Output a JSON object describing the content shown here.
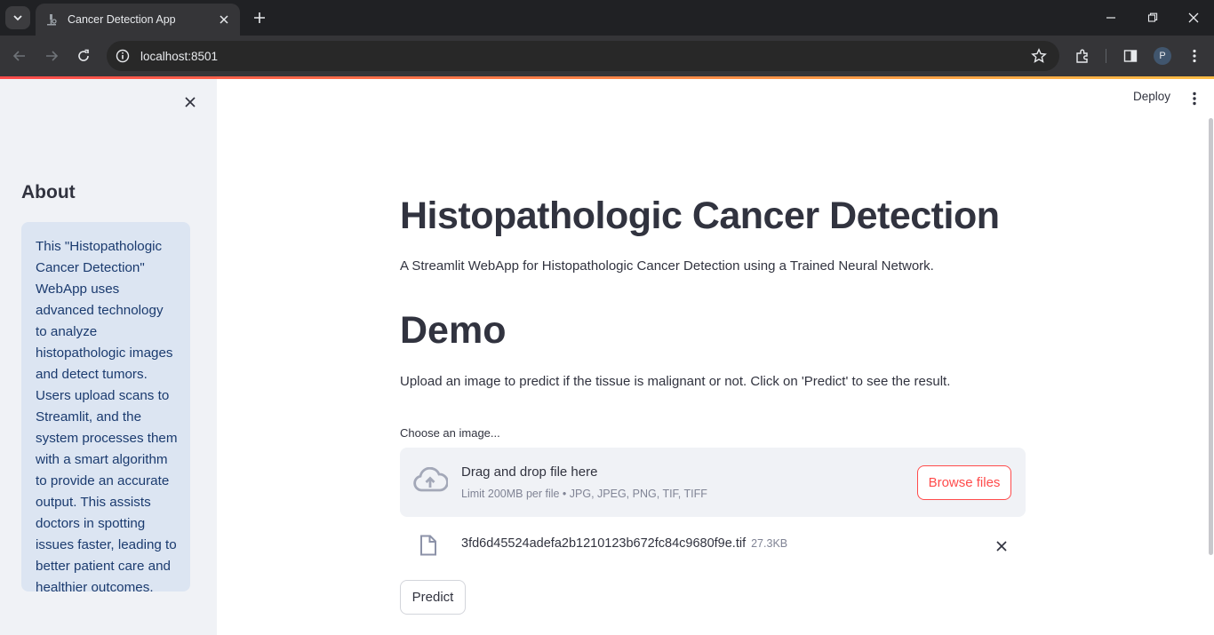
{
  "browser": {
    "tab_title": "Cancer Detection App",
    "url": "localhost:8501",
    "profile_initial": "P"
  },
  "header": {
    "deploy_label": "Deploy"
  },
  "sidebar": {
    "title": "About",
    "info_text": "This \"Histopathologic Cancer Detection\" WebApp uses advanced technology to analyze histopathologic images and detect tumors. Users upload scans to Streamlit, and the system processes them with a smart algorithm to provide an accurate output. This assists doctors in spotting issues faster, leading to better patient care and healthier outcomes."
  },
  "main": {
    "title": "Histopathologic Cancer Detection",
    "subtitle": "A Streamlit WebApp for Histopathologic Cancer Detection using a Trained Neural Network.",
    "section_title": "Demo",
    "instructions": "Upload an image to predict if the tissue is malignant or not. Click on 'Predict' to see the result.",
    "uploader": {
      "label": "Choose an image...",
      "drop_text": "Drag and drop file here",
      "limit_text": "Limit 200MB per file • JPG, JPEG, PNG, TIF, TIFF",
      "browse_label": "Browse files",
      "file_name": "3fd6d45524adefa2b1210123b672fc84c9680f9e.tif",
      "file_size": "27.3KB"
    },
    "predict_label": "Predict"
  },
  "colors": {
    "accent": "#ff4b4b",
    "sidebar_bg": "#f0f2f6",
    "info_bg": "#dce5f2",
    "info_text": "#1b3b6f"
  }
}
